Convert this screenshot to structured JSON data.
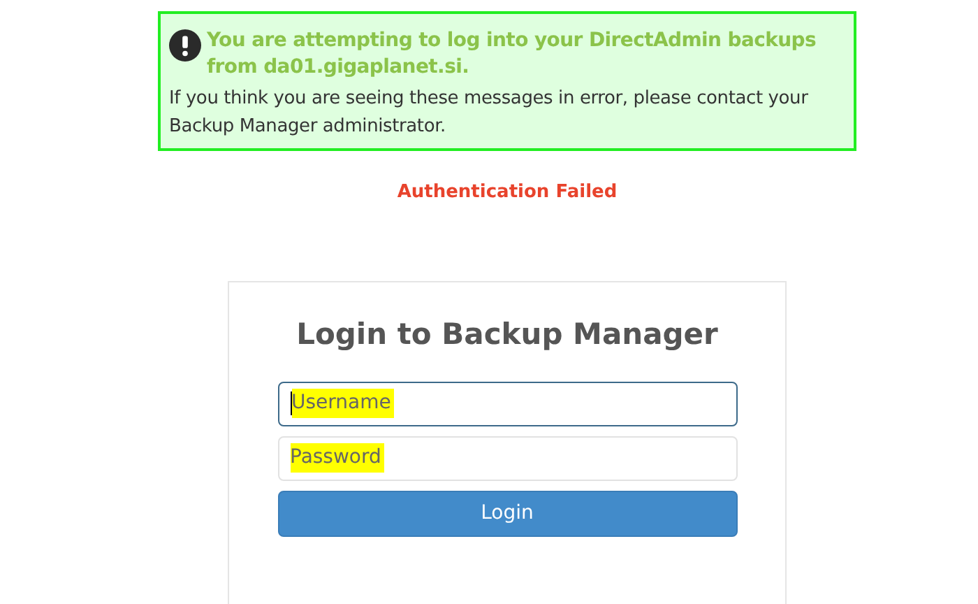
{
  "alert": {
    "title": "You are attempting to log into your DirectAdmin backups from da01.gigaplanet.si.",
    "message": "If you think you are seeing these messages in error, please contact your Backup Manager administrator."
  },
  "error": "Authentication Failed",
  "login": {
    "title": "Login to Backup Manager",
    "fields": [
      {
        "placeholder": "Username",
        "focused": true,
        "highlighted": true
      },
      {
        "placeholder": "Password",
        "focused": false,
        "highlighted": true
      }
    ],
    "button": "Login"
  }
}
